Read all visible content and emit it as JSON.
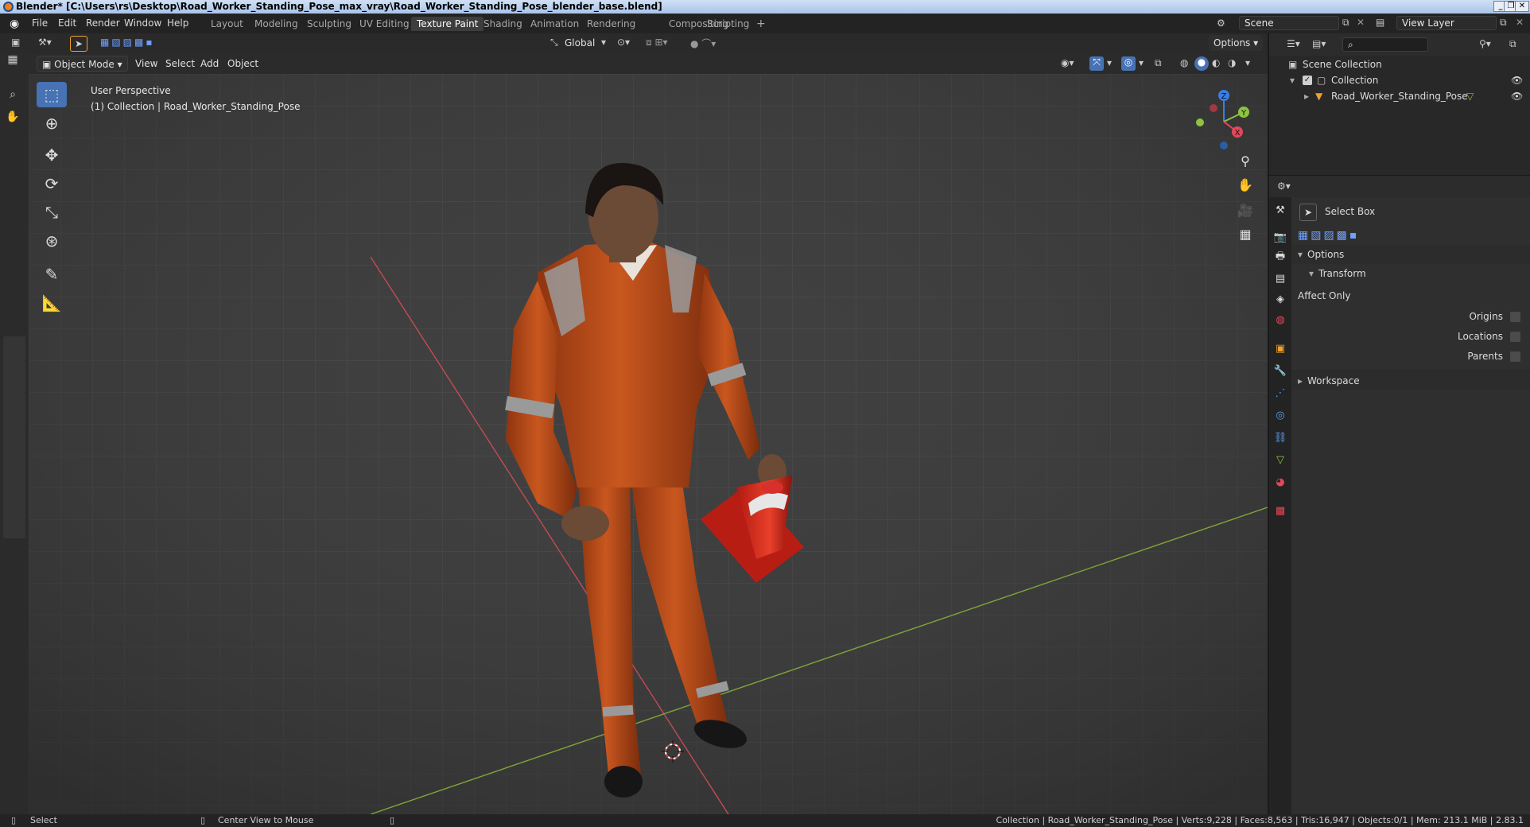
{
  "window": {
    "title": "Blender* [C:\\Users\\rs\\Desktop\\Road_Worker_Standing_Pose_max_vray\\Road_Worker_Standing_Pose_blender_base.blend]",
    "controls": [
      "_",
      "❐",
      "✕"
    ]
  },
  "menu": [
    "File",
    "Edit",
    "Render",
    "Window",
    "Help"
  ],
  "workspaces": {
    "tabs": [
      "Layout",
      "Modeling",
      "Sculpting",
      "UV Editing",
      "Texture Paint",
      "Shading",
      "Animation",
      "Rendering",
      "Compositing",
      "Scripting"
    ],
    "active": "Texture Paint",
    "add": "+"
  },
  "scene": {
    "name": "Scene",
    "view_layer": "View Layer"
  },
  "viewport_header": {
    "transform_orientation": "Global",
    "options_label": "Options",
    "mode": "Object Mode",
    "menus": [
      "View",
      "Select",
      "Add",
      "Object"
    ]
  },
  "viewport": {
    "perspective_label": "User Perspective",
    "collection_label": "(1) Collection | Road_Worker_Standing_Pose",
    "gizmo_axes": [
      "Z",
      "Y",
      "X"
    ]
  },
  "outliner": {
    "root": "Scene Collection",
    "collection": "Collection",
    "object": "Road_Worker_Standing_Pose"
  },
  "properties": {
    "tool_name": "Select Box",
    "panel_options": "Options",
    "subpanel_transform": "Transform",
    "affect_only": "Affect Only",
    "checkboxes": [
      "Origins",
      "Locations",
      "Parents"
    ],
    "panel_workspace": "Workspace"
  },
  "statusbar": {
    "left_hint": "Select",
    "mid_hint": "Center View to Mouse",
    "stats": "Collection | Road_Worker_Standing_Pose | Verts:9,228 | Faces:8,563 | Tris:16,947 | Objects:0/1 | Mem: 213.1 MiB | 2.83.1"
  },
  "colors": {
    "accent": "#4772b3",
    "axis_x": "#e2485a",
    "axis_y": "#8cc43f",
    "axis_z": "#3a7ee0",
    "viewport_bg": "#3f3f3f",
    "workwear": "#c2511f"
  }
}
